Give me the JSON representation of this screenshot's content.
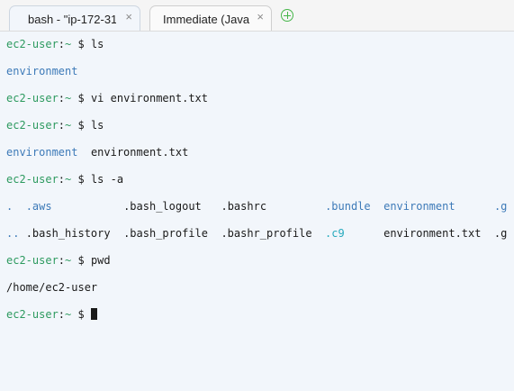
{
  "tabs": [
    {
      "label": "bash - \"ip-172-31",
      "close": "×",
      "active": true
    },
    {
      "label": "Immediate (Java",
      "close": "×",
      "active": false
    }
  ],
  "new_tab_icon": "plus-circle-icon",
  "colors": {
    "prompt": "#2d9a5f",
    "directory": "#3d7ab8",
    "hidden_dir_cyan": "#27aabd",
    "new_tab": "#45b549",
    "background": "#f2f6fb"
  },
  "prompt": {
    "user": "ec2-user",
    "sep": ":",
    "path": "~",
    "symbol": " $ "
  },
  "terminal": {
    "cmd1": "ls",
    "out1_dir": "environment",
    "cmd2": "vi environment.txt",
    "cmd3": "ls",
    "out3_dir": "environment",
    "out3_gap": "  ",
    "out3_file": "environment.txt",
    "cmd4": "ls -a",
    "la_row1": {
      "c1": ".",
      "g1": "  ",
      "c2": ".aws",
      "g2": "           ",
      "c3": ".bash_logout",
      "g3": "   ",
      "c4": ".bashrc",
      "g4": "         ",
      "c5": ".bundle",
      "g5": "  ",
      "c6": "environment",
      "g6": "      ",
      "c7": ".g"
    },
    "la_row2": {
      "c1": "..",
      "g1": " ",
      "c2": ".bash_history",
      "g2": "  ",
      "c3": ".bash_profile",
      "g3": "  ",
      "c4": ".bashr_profile",
      "g4": "  ",
      "c5": ".c9",
      "g5": "      ",
      "c6": "environment.txt",
      "g6": "  ",
      "c7": ".g"
    },
    "cmd5": "pwd",
    "out5": "/home/ec2-user"
  }
}
